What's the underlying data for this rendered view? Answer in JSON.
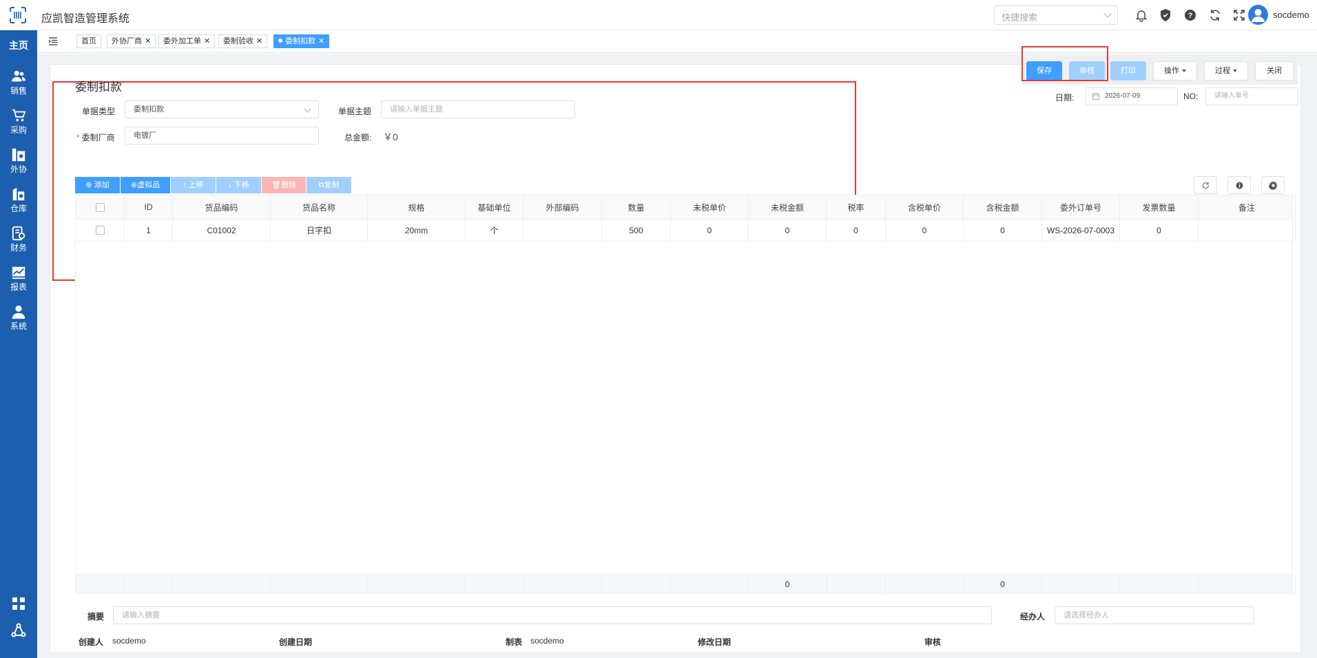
{
  "app": {
    "title": "应凯智造管理系统",
    "user": "socdemo"
  },
  "header": {
    "search_placeholder": "快捷搜索"
  },
  "sidebar": {
    "home": "主页",
    "items": [
      {
        "label": "销售",
        "icon": "users-icon"
      },
      {
        "label": "采购",
        "icon": "cart-icon"
      },
      {
        "label": "外协",
        "icon": "outsource-icon"
      },
      {
        "label": "仓库",
        "icon": "warehouse-icon"
      },
      {
        "label": "财务",
        "icon": "finance-icon"
      },
      {
        "label": "报表",
        "icon": "report-icon"
      },
      {
        "label": "系统",
        "icon": "user-icon"
      }
    ]
  },
  "tabs": [
    {
      "label": "首页",
      "closable": false
    },
    {
      "label": "外协厂商",
      "closable": true
    },
    {
      "label": "委外加工单",
      "closable": true
    },
    {
      "label": "委制验收",
      "closable": true
    },
    {
      "label": "委制扣款",
      "closable": true,
      "active": true
    }
  ],
  "actions": {
    "save": "保存",
    "audit": "审核",
    "print": "打印",
    "operate": "操作",
    "process": "过程",
    "close": "关闭"
  },
  "form": {
    "title": "委制扣款",
    "doc_type_label": "单据类型",
    "doc_type_value": "委制扣款",
    "subject_label": "单据主题",
    "subject_placeholder": "请输入单据主题",
    "vendor_label": "委制厂商",
    "vendor_value": "电镀厂",
    "total_label": "总金额:",
    "total_value": "￥0",
    "date_label": "日期:",
    "date_value": "2026-07-09",
    "no_label": "NO:",
    "no_placeholder": "请输入单号"
  },
  "grid_toolbar": {
    "add": "添加",
    "virtual": "虚拟品",
    "up": "上移",
    "down": "下移",
    "delete": "删除",
    "copy": "复制"
  },
  "table": {
    "columns": [
      "",
      "ID",
      "货品编码",
      "货品名称",
      "规格",
      "基础单位",
      "外部编码",
      "数量",
      "未税单价",
      "未税金额",
      "税率",
      "含税单价",
      "含税金额",
      "委外订单号",
      "发票数量",
      "备注"
    ],
    "rows": [
      [
        "",
        "1",
        "C01002",
        "日字扣",
        "20mm",
        "个",
        "",
        "500",
        "0",
        "0",
        "0",
        "0",
        "0",
        "WS-2026-07-0003",
        "0",
        ""
      ]
    ],
    "footer": [
      "",
      "",
      "",
      "",
      "",
      "",
      "",
      "",
      "",
      "0",
      "",
      "",
      "0",
      "",
      "",
      ""
    ]
  },
  "footer": {
    "summary_label": "摘要",
    "summary_placeholder": "请输入摘要",
    "handler_label": "经办人",
    "handler_placeholder": "请选择经办人",
    "creator_label": "创建人",
    "creator_value": "socdemo",
    "created_date_label": "创建日期",
    "maker_label": "制表",
    "maker_value": "socdemo",
    "modified_date_label": "修改日期",
    "auditor_label": "审核"
  }
}
